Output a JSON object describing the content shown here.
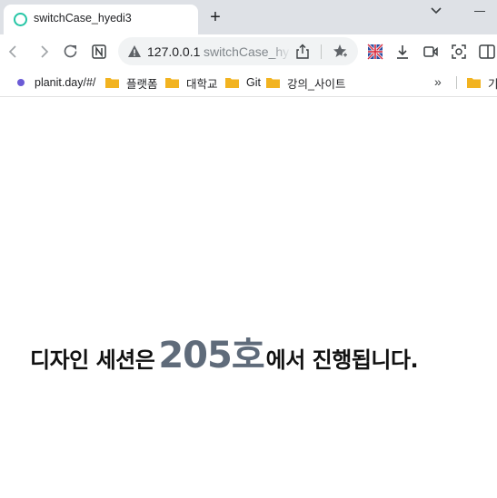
{
  "tab": {
    "title": "switchCase_hyedi3",
    "new_tab_label": "+"
  },
  "address_bar": {
    "host": "127.0.0.1",
    "path": "switchCase_hyedi3"
  },
  "bookmarks": {
    "items": [
      {
        "label": "planit.day/#/",
        "icon": "site-dot-icon"
      },
      {
        "label": "플랫폼",
        "icon": "folder-icon"
      },
      {
        "label": "대학교",
        "icon": "folder-icon"
      },
      {
        "label": "Git",
        "icon": "folder-icon"
      },
      {
        "label": "강의_사이트",
        "icon": "folder-icon"
      }
    ],
    "overflow_label": "»",
    "other_label": "기"
  },
  "content": {
    "prefix": "디자인 세션은",
    "room": "205호",
    "suffix": "에서 진행됩니다."
  },
  "colors": {
    "accent_favicon": "#26c6a6",
    "room_text": "#5f6b7a",
    "folder": "#f2b320"
  }
}
